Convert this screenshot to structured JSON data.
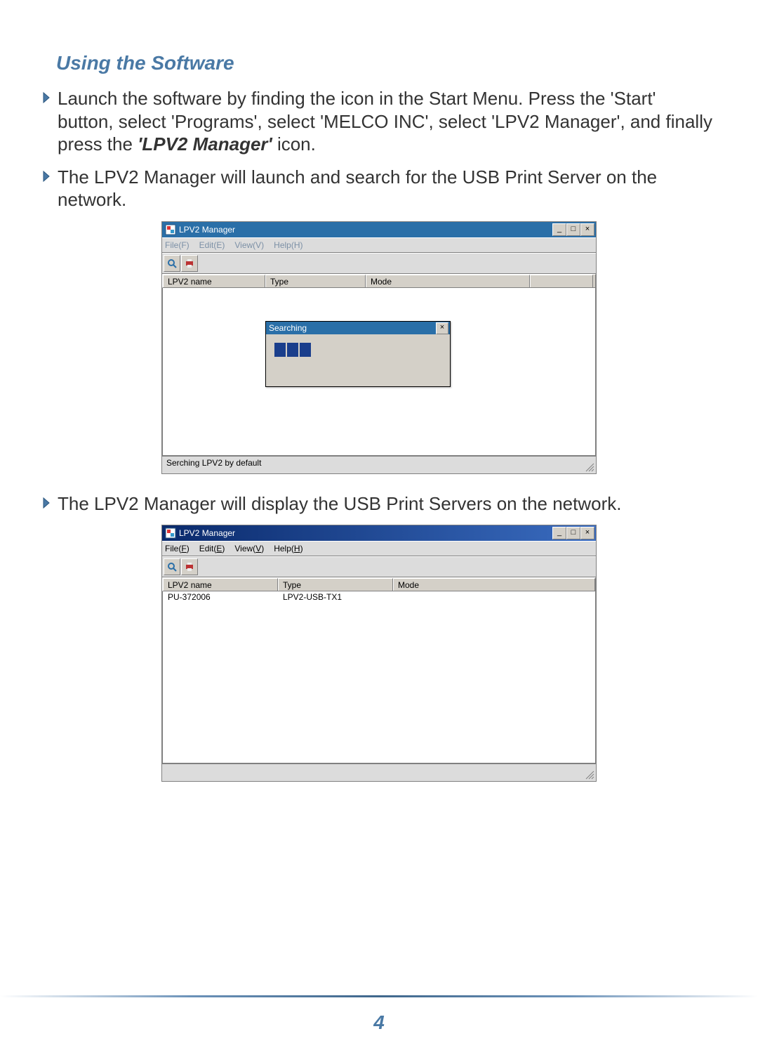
{
  "section_title": "Using the Software",
  "bullets": {
    "b1_pre": "Launch the software by finding the icon in the Start Menu.  Press the 'Start' button, select 'Programs', select 'MELCO INC', select 'LPV2 Manager', and finally press the ",
    "b1_em": "'LPV2 Manager'",
    "b1_post": " icon.",
    "b2": "The LPV2 Manager will launch and search for the USB Print Server on the network.",
    "b3": "The LPV2 Manager will display the USB Print Servers on the network."
  },
  "win1": {
    "title": "LPV2 Manager",
    "menu": {
      "file": "File(F)",
      "edit": "Edit(E)",
      "view": "View(V)",
      "help": "Help(H)"
    },
    "cols": {
      "c1": "LPV2 name",
      "c2": "Type",
      "c3": "Mode"
    },
    "search_dlg_title": "Searching",
    "status": "Serching LPV2 by default"
  },
  "win2": {
    "title": "LPV2 Manager",
    "menu": {
      "file": "File(F)",
      "edit": "Edit(E)",
      "view": "View(V)",
      "help": "Help(H)"
    },
    "cols": {
      "c1": "LPV2 name",
      "c2": "Type",
      "c3": "Mode"
    },
    "rows": [
      {
        "name": "PU-372006",
        "type": "LPV2-USB-TX1",
        "mode": ""
      }
    ],
    "status": ""
  },
  "page_number": "4",
  "win_controls": {
    "min": "_",
    "max": "□",
    "close": "×"
  }
}
